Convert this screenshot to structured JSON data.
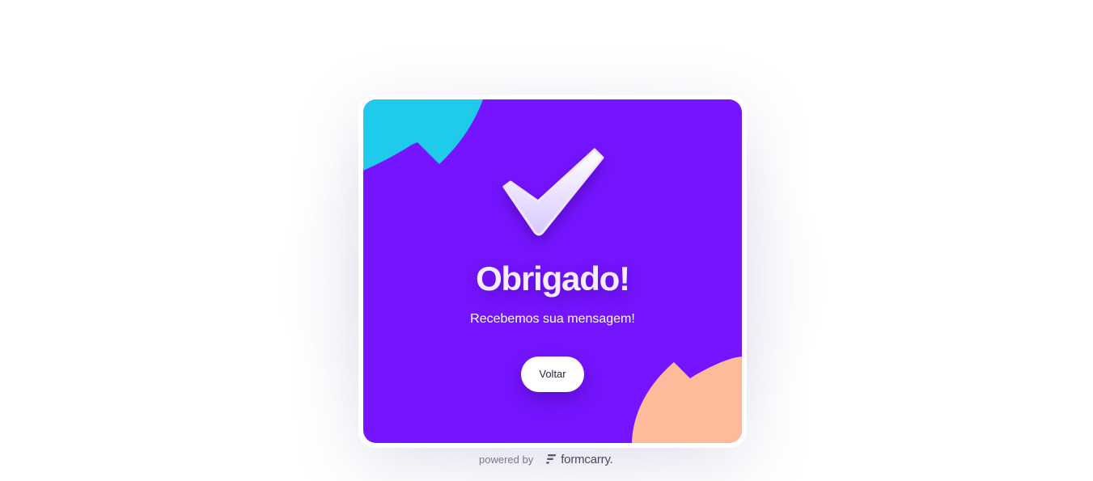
{
  "card": {
    "title": "Obrigado!",
    "subtitle": "Recebemos sua mensagem!",
    "back_button_label": "Voltar",
    "icon": "checkmark-icon"
  },
  "footer": {
    "powered_by": "powered by",
    "brand": "formcarry.",
    "brand_icon": "formcarry-logo-icon"
  },
  "colors": {
    "card_background": "#7514ff",
    "blob_top_left": "#1ecbeb",
    "blob_bottom_right": "#fdbb9c",
    "button_background": "#ffffff"
  }
}
